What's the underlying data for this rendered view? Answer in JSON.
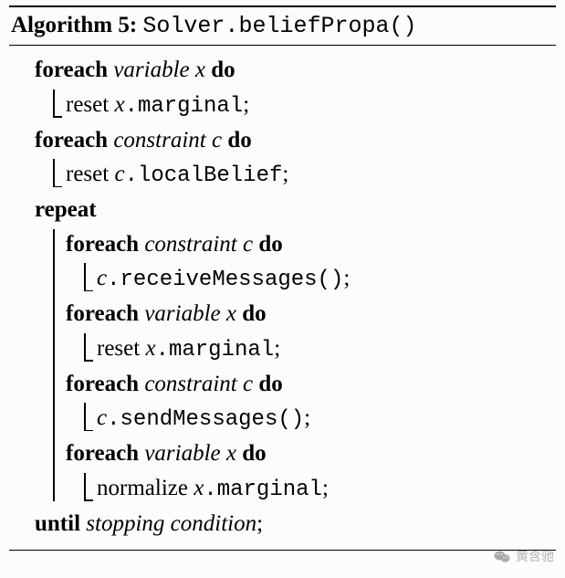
{
  "title": {
    "label": "Algorithm 5:",
    "code": "Solver.beliefPropa()"
  },
  "kw": {
    "foreach": "foreach",
    "do": "do",
    "repeat": "repeat",
    "until": "until"
  },
  "txt": {
    "reset": "reset ",
    "normalize": "normalize ",
    "variable_x": "variable x",
    "constraint_c": "constraint c",
    "x": "x",
    "c": "c",
    "stopping_condition": "stopping condition",
    "semi": ";",
    "sp": " "
  },
  "code": {
    "marginal": ".marginal",
    "localBelief": ".localBelief",
    "receiveMessages": ".receiveMessages()",
    "sendMessages": ".sendMessages()"
  },
  "watermark": {
    "author": "黄含驰"
  }
}
